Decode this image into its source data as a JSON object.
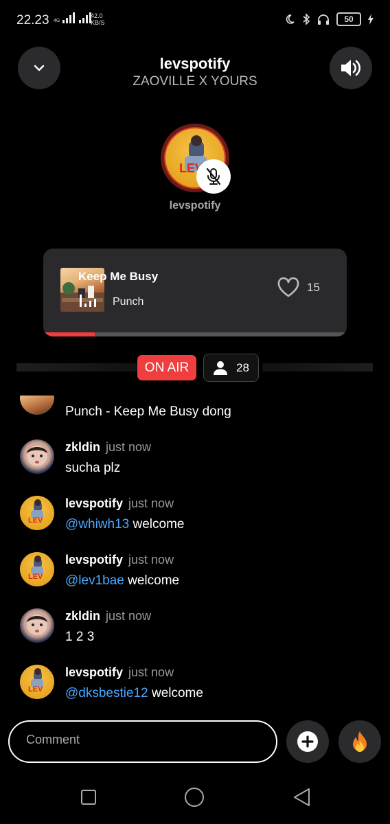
{
  "status_bar": {
    "time": "22.23",
    "network_label": "4G",
    "speed_value": "42.0",
    "speed_unit": "KB/S",
    "battery": "50",
    "icons": [
      "moon-icon",
      "bluetooth-icon",
      "headphones-icon",
      "battery-icon",
      "charging-icon"
    ]
  },
  "header": {
    "host_name": "levspotify",
    "room_title": "ZAOVILLE X YOURS"
  },
  "host": {
    "name": "levspotify",
    "avatar_text": "LEV",
    "muted": true
  },
  "now_playing": {
    "title": "Keep Me Busy",
    "artist": "Punch",
    "likes": "15",
    "progress": 0.17
  },
  "live": {
    "on_air_label": "ON AIR",
    "listener_count": "28"
  },
  "chat": {
    "messages": [
      {
        "user": "",
        "time": "",
        "text": "Punch - Keep Me Busy dong",
        "avatar": "album-art"
      },
      {
        "user": "zkldin",
        "time": "just now",
        "text": "sucha plz",
        "avatar": "kid"
      },
      {
        "user": "levspotify",
        "time": "just now",
        "mention": "@whiwh13",
        "text": " welcome",
        "avatar": "lev"
      },
      {
        "user": "levspotify",
        "time": "just now",
        "mention": "@lev1bae",
        "text": " welcome",
        "avatar": "lev"
      },
      {
        "user": "zkldin",
        "time": "just now",
        "text": "1 2 3",
        "avatar": "kid"
      },
      {
        "user": "levspotify",
        "time": "just now",
        "mention": "@dksbestie12",
        "text": " welcome",
        "avatar": "lev"
      }
    ]
  },
  "comment": {
    "placeholder": "Comment"
  },
  "colors": {
    "accent_red": "#f03e3e",
    "mention_blue": "#4aa8ff",
    "card_bg": "#2a2a2c"
  }
}
